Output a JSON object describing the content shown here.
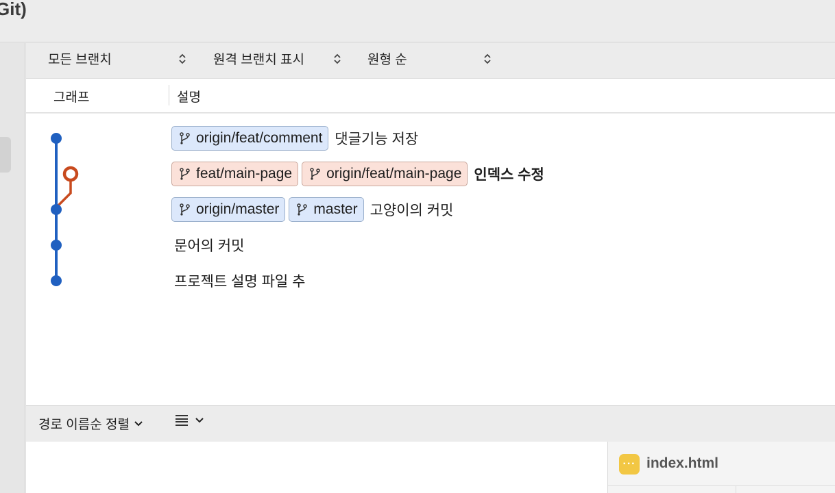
{
  "window": {
    "title": "Git)"
  },
  "filters": {
    "branches": "모든 브랜치",
    "remote": "원격 브랜치 표시",
    "order": "원형 순"
  },
  "columns": {
    "graph": "그래프",
    "description": "설명"
  },
  "commits": [
    {
      "refs": [
        {
          "name": "origin/feat/comment",
          "color": "blue"
        }
      ],
      "message": "댓글기능 저장",
      "bold": false
    },
    {
      "refs": [
        {
          "name": "feat/main-page",
          "color": "pink"
        },
        {
          "name": "origin/feat/main-page",
          "color": "pink"
        }
      ],
      "message": "인덱스 수정",
      "bold": true
    },
    {
      "refs": [
        {
          "name": "origin/master",
          "color": "blue"
        },
        {
          "name": "master",
          "color": "blue"
        }
      ],
      "message": "고양이의 커밋",
      "bold": false
    },
    {
      "refs": [],
      "message": "문어의 커밋",
      "bold": false
    },
    {
      "refs": [],
      "message": "프로젝트 설명 파일 추",
      "bold": false
    }
  ],
  "bottom": {
    "sort_label": "경로 이름순 정렬",
    "view_icon": "list-lines-icon"
  },
  "file_panel": {
    "filename": "index.html",
    "icon": "ellipsis-file-icon"
  },
  "colors": {
    "graph_main": "#2060c0",
    "graph_branch": "#c84a1e",
    "chip_blue_bg": "#dce8fb",
    "chip_pink_bg": "#fbe1d9",
    "file_icon": "#f2c744"
  }
}
